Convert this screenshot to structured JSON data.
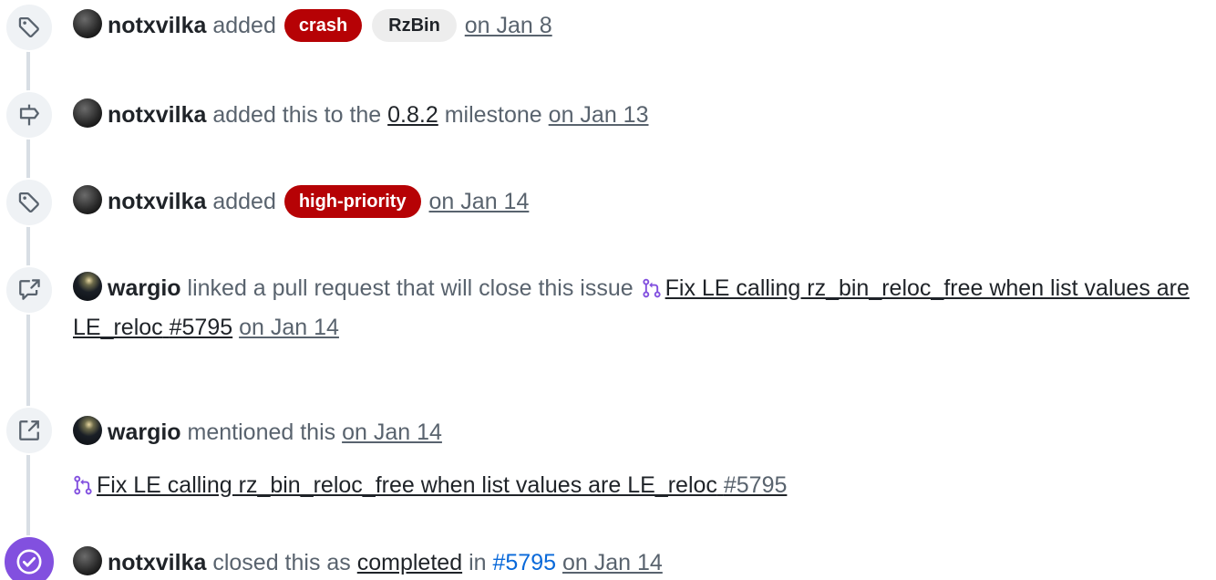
{
  "events": [
    {
      "user": "notxvilka",
      "action": "added",
      "labels": [
        {
          "text": "crash",
          "color": "#b60205"
        },
        {
          "text": "RzBin",
          "color": "#ededed"
        }
      ],
      "date": "on Jan 8"
    },
    {
      "user": "notxvilka",
      "action_before": "added this to the",
      "milestone": "0.8.2",
      "action_after": "milestone",
      "date": "on Jan 13"
    },
    {
      "user": "notxvilka",
      "action": "added",
      "labels": [
        {
          "text": "high-priority",
          "color": "#b60205"
        }
      ],
      "date": "on Jan 14"
    },
    {
      "user": "wargio",
      "action": "linked a pull request that will close this issue",
      "pr_title": "Fix LE calling rz_bin_reloc_free when list values are LE_reloc",
      "pr_number": "#5795",
      "date": "on Jan 14"
    },
    {
      "user": "wargio",
      "action": "mentioned this",
      "date": "on Jan 14",
      "ref_title": "Fix LE calling rz_bin_reloc_free when list values are LE_reloc",
      "ref_number": "#5795"
    },
    {
      "user": "notxvilka",
      "action_before": "closed this as",
      "state": "completed",
      "action_mid": "in",
      "pr_number": "#5795",
      "date": "on Jan 14"
    }
  ],
  "icons": {
    "label": "tag-icon",
    "milestone": "milestone-icon",
    "linked": "cross-reference-icon",
    "mention": "link-external-icon",
    "pull_request": "git-pull-request-icon",
    "closed": "check-circle-icon"
  },
  "colors": {
    "pr_icon": "#8250df",
    "closed_badge": "#8250df",
    "label_red": "#b60205",
    "link_blue": "#0969da"
  }
}
